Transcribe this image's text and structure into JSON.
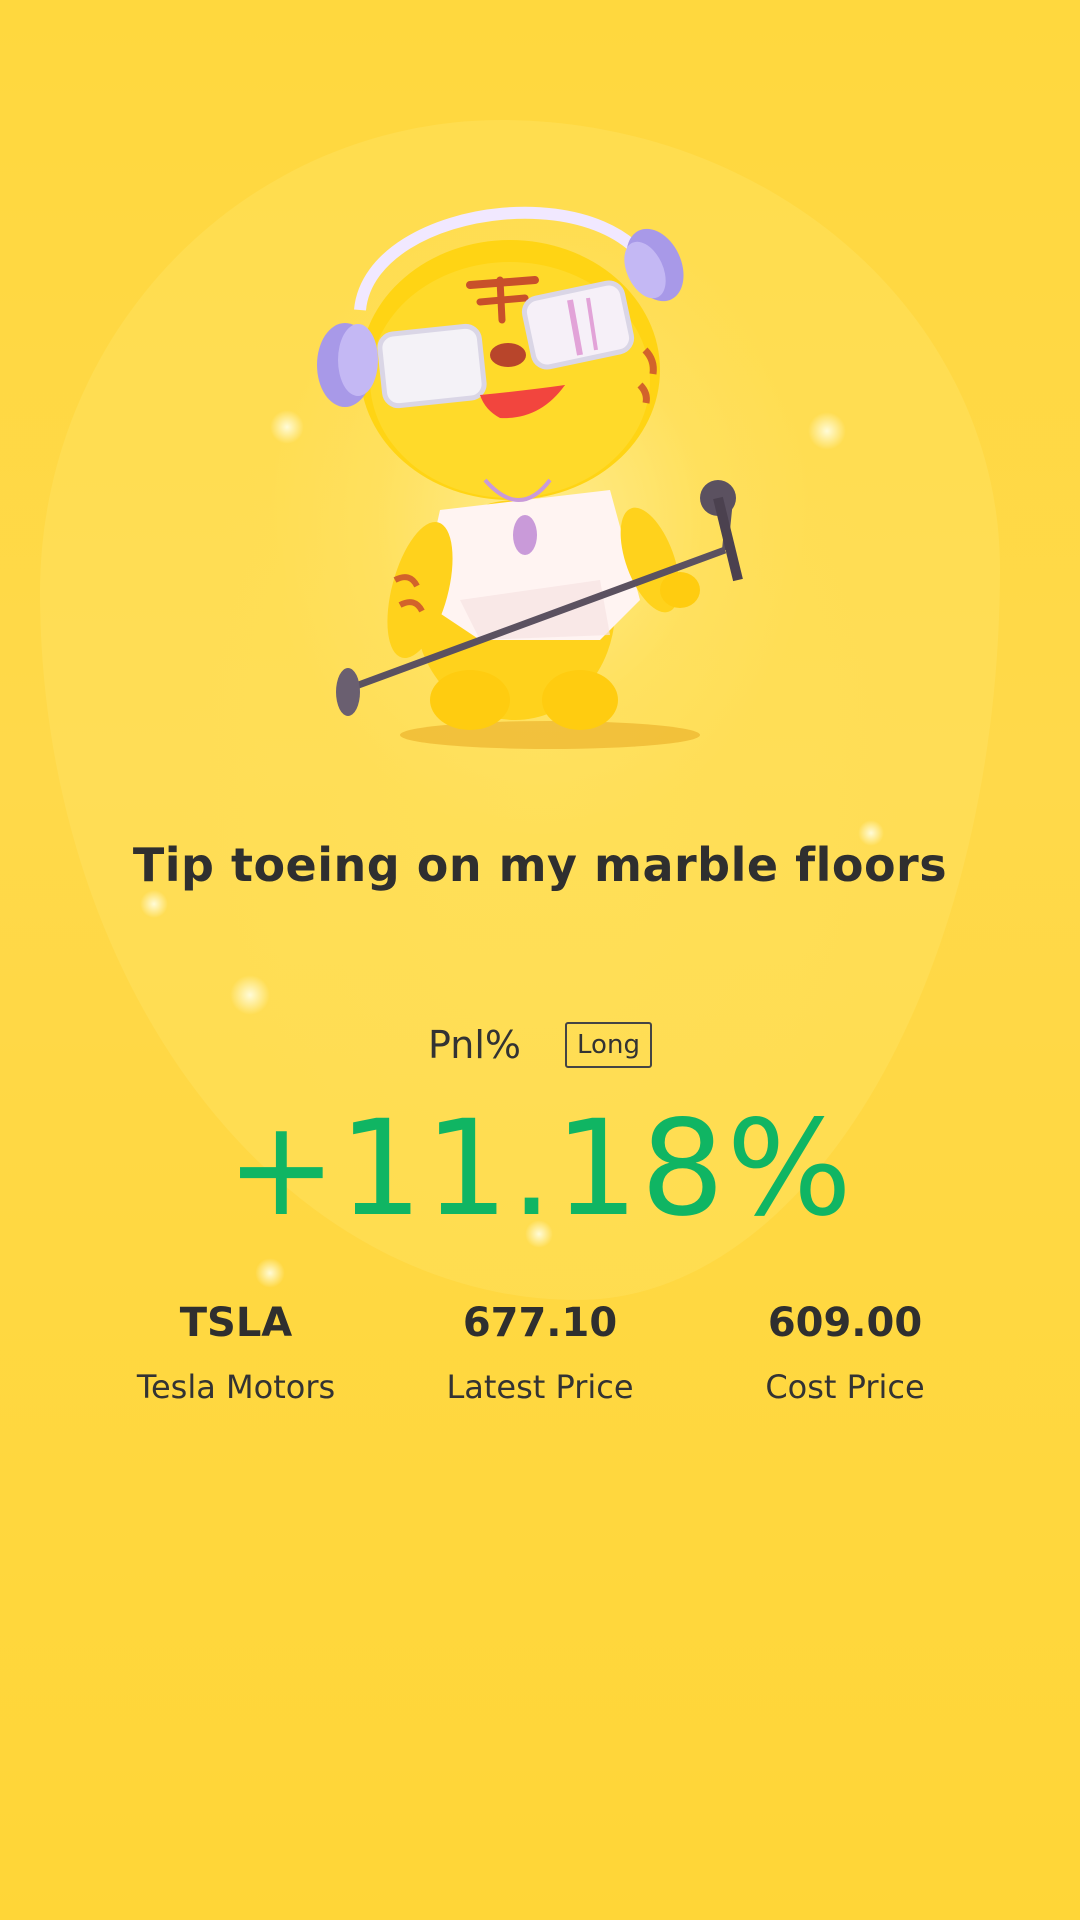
{
  "headline": "Tip toeing on my marble floors",
  "pnl": {
    "label": "Pnl%",
    "badge": "Long",
    "value": "+11.18%",
    "color": "#10b563"
  },
  "stats": [
    {
      "value": "TSLA",
      "label": "Tesla Motors"
    },
    {
      "value": "677.10",
      "label": "Latest Price"
    },
    {
      "value": "609.00",
      "label": "Cost Price"
    }
  ],
  "mascot": {
    "icon": "tiger-mascot-with-headphones-and-microphone-icon"
  },
  "colors": {
    "background": "#ffd633",
    "text": "#2f2f2f"
  }
}
